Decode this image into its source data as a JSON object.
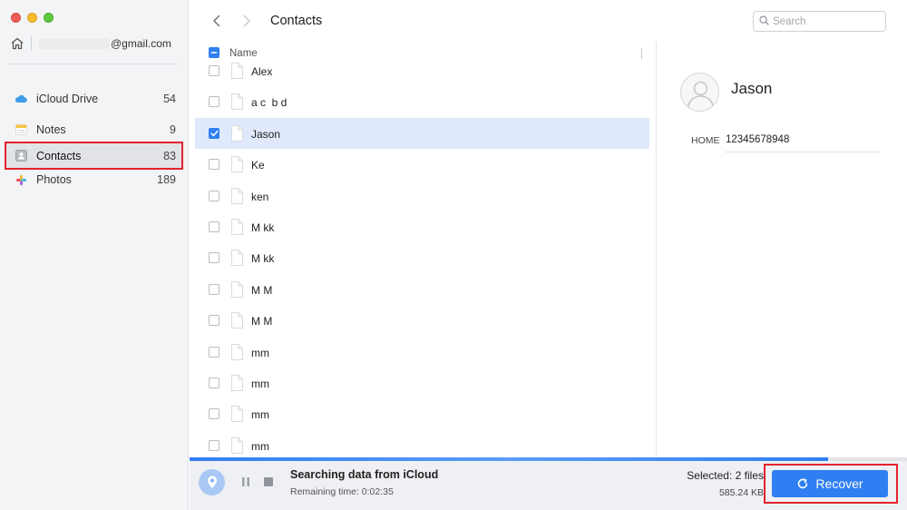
{
  "sidebar": {
    "account_email": "@gmail.com",
    "items": [
      {
        "label": "iCloud Drive",
        "count": "54",
        "icon": "cloud-icon"
      },
      {
        "label": "Notes",
        "count": "9",
        "icon": "notes-icon"
      },
      {
        "label": "Contacts",
        "count": "83",
        "icon": "contacts-icon"
      },
      {
        "label": "Photos",
        "count": "189",
        "icon": "photos-icon"
      }
    ]
  },
  "header": {
    "title": "Contacts",
    "search_placeholder": "Search"
  },
  "list": {
    "column_name": "Name",
    "rows": [
      {
        "name": "Alex",
        "checked": false
      },
      {
        "name": "a c  b d",
        "checked": false
      },
      {
        "name": "Jason",
        "checked": true
      },
      {
        "name": "Ke",
        "checked": false
      },
      {
        "name": "ken",
        "checked": false
      },
      {
        "name": "M kk",
        "checked": false
      },
      {
        "name": "M kk",
        "checked": false
      },
      {
        "name": "M M",
        "checked": false
      },
      {
        "name": "M M",
        "checked": false
      },
      {
        "name": "mm",
        "checked": false
      },
      {
        "name": "mm",
        "checked": false
      },
      {
        "name": "mm",
        "checked": false
      },
      {
        "name": "mm",
        "checked": false
      }
    ]
  },
  "detail": {
    "name": "Jason",
    "field_label": "HOME",
    "field_value": "12345678948"
  },
  "status": {
    "title": "Searching data from iCloud",
    "remaining": "Remaining time: 0:02:35",
    "progress": 0.89
  },
  "selection": {
    "summary": "Selected: 2 files",
    "size": "585.24 KB"
  },
  "actions": {
    "recover_label": "Recover"
  },
  "colors": {
    "accent": "#2f7ff2",
    "highlight_border": "#e3232b",
    "selected_row": "#dfe9fb"
  }
}
